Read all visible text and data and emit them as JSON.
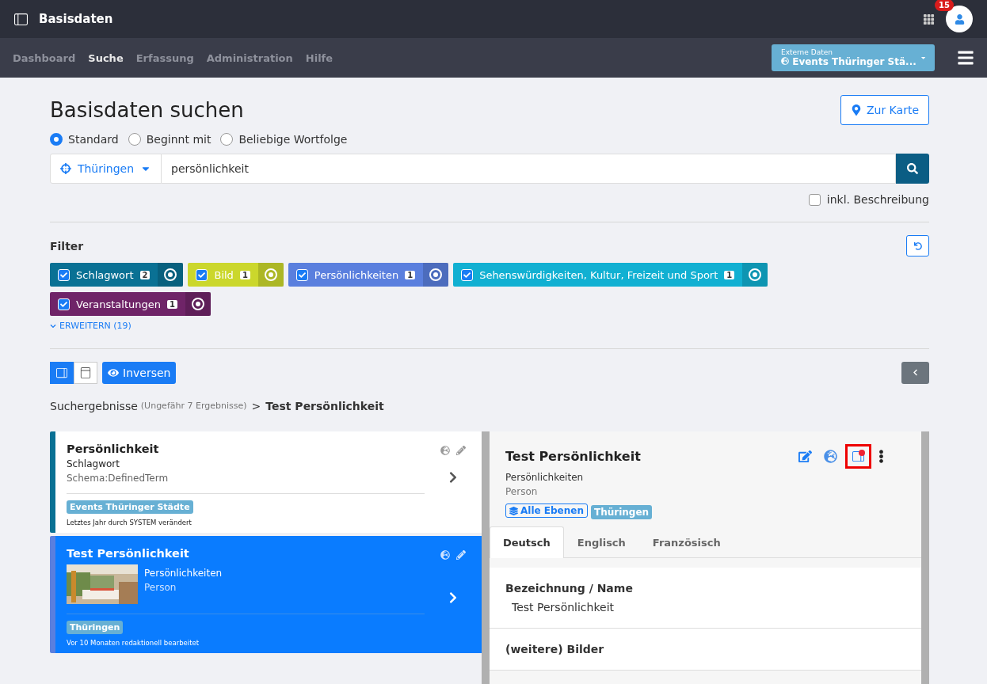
{
  "topbar": {
    "title": "Basisdaten",
    "notification_count": "15"
  },
  "nav": {
    "items": [
      {
        "label": "Dashboard",
        "selected": false
      },
      {
        "label": "Suche",
        "selected": true
      },
      {
        "label": "Erfassung",
        "selected": false
      },
      {
        "label": "Administration",
        "selected": false
      },
      {
        "label": "Hilfe",
        "selected": false
      }
    ],
    "source_select": {
      "label": "Externe Daten",
      "value": "Events Thüringer Stä..."
    }
  },
  "page": {
    "title": "Basisdaten suchen",
    "map_button": "Zur Karte"
  },
  "search_modes": [
    {
      "label": "Standard",
      "selected": true
    },
    {
      "label": "Beginnt mit",
      "selected": false
    },
    {
      "label": "Beliebige Wortfolge",
      "selected": false
    }
  ],
  "search": {
    "region": "Thüringen",
    "value": "persönlichkeit",
    "include_description": {
      "label": "inkl. Beschreibung",
      "checked": false
    }
  },
  "filter": {
    "title": "Filter",
    "chips": [
      {
        "label": "Schlagwort",
        "count": "2",
        "checked": true,
        "color": "#0a7194"
      },
      {
        "label": "Bild",
        "count": "1",
        "checked": true,
        "color": "#cbd72c"
      },
      {
        "label": "Persönlichkeiten",
        "count": "1",
        "checked": true,
        "color": "#5a7fde"
      },
      {
        "label": "Sehenswürdigkeiten, Kultur, Freizeit und Sport",
        "count": "1",
        "checked": true,
        "color": "#11b0d2"
      },
      {
        "label": "Veranstaltungen",
        "count": "1",
        "checked": true,
        "color": "#6f2468"
      }
    ],
    "expand_link": "ERWEITERN (19)"
  },
  "view_toolbar": {
    "views": [
      {
        "kind": "split",
        "selected": true
      },
      {
        "kind": "full",
        "selected": false
      }
    ],
    "inverse_button": "Inversen"
  },
  "breadcrumb": {
    "root": "Suchergebnisse",
    "count": "(Ungefähr 7 Ergebnisse)",
    "separator": ">",
    "current": "Test Persönlichkeit"
  },
  "results": [
    {
      "title": "Persönlichkeit",
      "line_1": "Schlagwort",
      "line_2": "Schema:DefinedTerm",
      "tag": "Events Thüringer Städte",
      "footer": "Letztes Jahr durch SYSTEM verändert",
      "selected": false,
      "has_image": false,
      "color": "#0a7194"
    },
    {
      "title": "Test Persönlichkeit",
      "line_1": "Persönlichkeiten",
      "line_2": "Person",
      "tag": "Thüringen",
      "footer": "Vor 10 Monaten redaktionell bearbeitet",
      "selected": true,
      "has_image": true,
      "color": "#5a7fde"
    }
  ],
  "detail": {
    "title": "Test Persönlichkeit",
    "line_1": "Persönlichkeiten",
    "line_2": "Person",
    "layers_tag": "Alle Ebenen",
    "region_tag": "Thüringen",
    "tabs": [
      {
        "label": "Deutsch",
        "selected": true
      },
      {
        "label": "Englisch",
        "selected": false
      },
      {
        "label": "Französisch",
        "selected": false
      }
    ],
    "fields": [
      {
        "label": "Bezeichnung / Name",
        "value": "Test Persönlichkeit"
      },
      {
        "label": "(weitere) Bilder"
      }
    ]
  }
}
